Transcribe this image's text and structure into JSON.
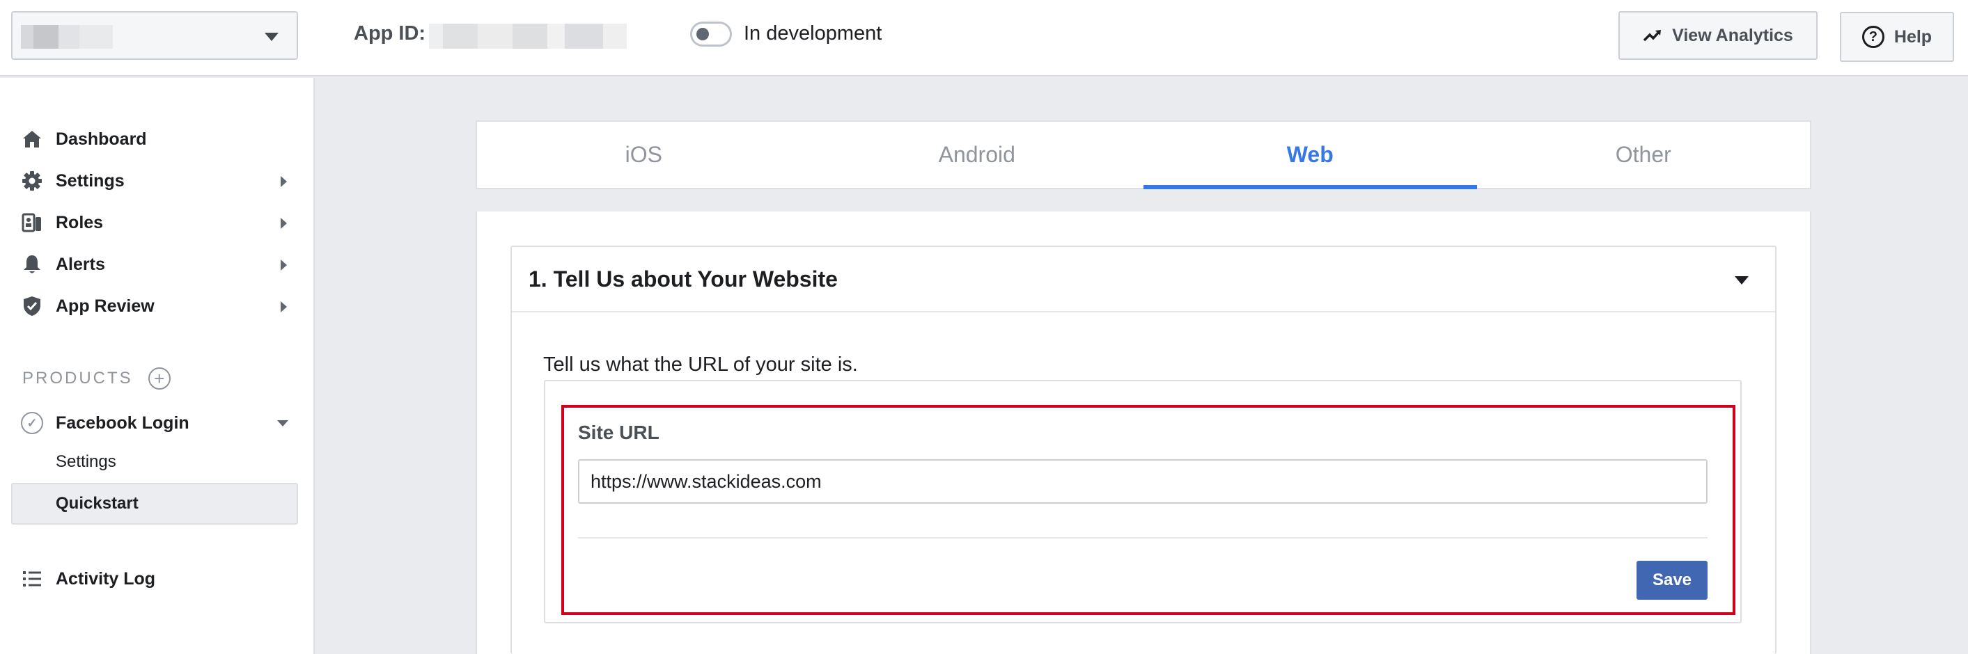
{
  "header": {
    "app_id_label": "App ID:",
    "status_label": "In development",
    "view_analytics_label": "View Analytics",
    "help_label": "Help"
  },
  "sidebar": {
    "items": [
      {
        "label": "Dashboard",
        "icon": "home-icon"
      },
      {
        "label": "Settings",
        "icon": "gear-icon"
      },
      {
        "label": "Roles",
        "icon": "roles-icon"
      },
      {
        "label": "Alerts",
        "icon": "bell-icon"
      },
      {
        "label": "App Review",
        "icon": "shield-icon"
      }
    ],
    "products_label": "PRODUCTS",
    "product": {
      "label": "Facebook Login",
      "sub_items": [
        {
          "label": "Settings"
        },
        {
          "label": "Quickstart",
          "selected": true
        }
      ]
    },
    "activity_log_label": "Activity Log"
  },
  "tabs": [
    {
      "label": "iOS"
    },
    {
      "label": "Android"
    },
    {
      "label": "Web",
      "active": true
    },
    {
      "label": "Other"
    }
  ],
  "section": {
    "title": "1. Tell Us about Your Website",
    "prompt": "Tell us what the URL of your site is.",
    "site_url_label": "Site URL",
    "site_url_value": "https://www.stackideas.com",
    "save_label": "Save"
  },
  "colors": {
    "accent": "#3578e5",
    "button": "#4267b2",
    "highlight": "#d0021b"
  }
}
